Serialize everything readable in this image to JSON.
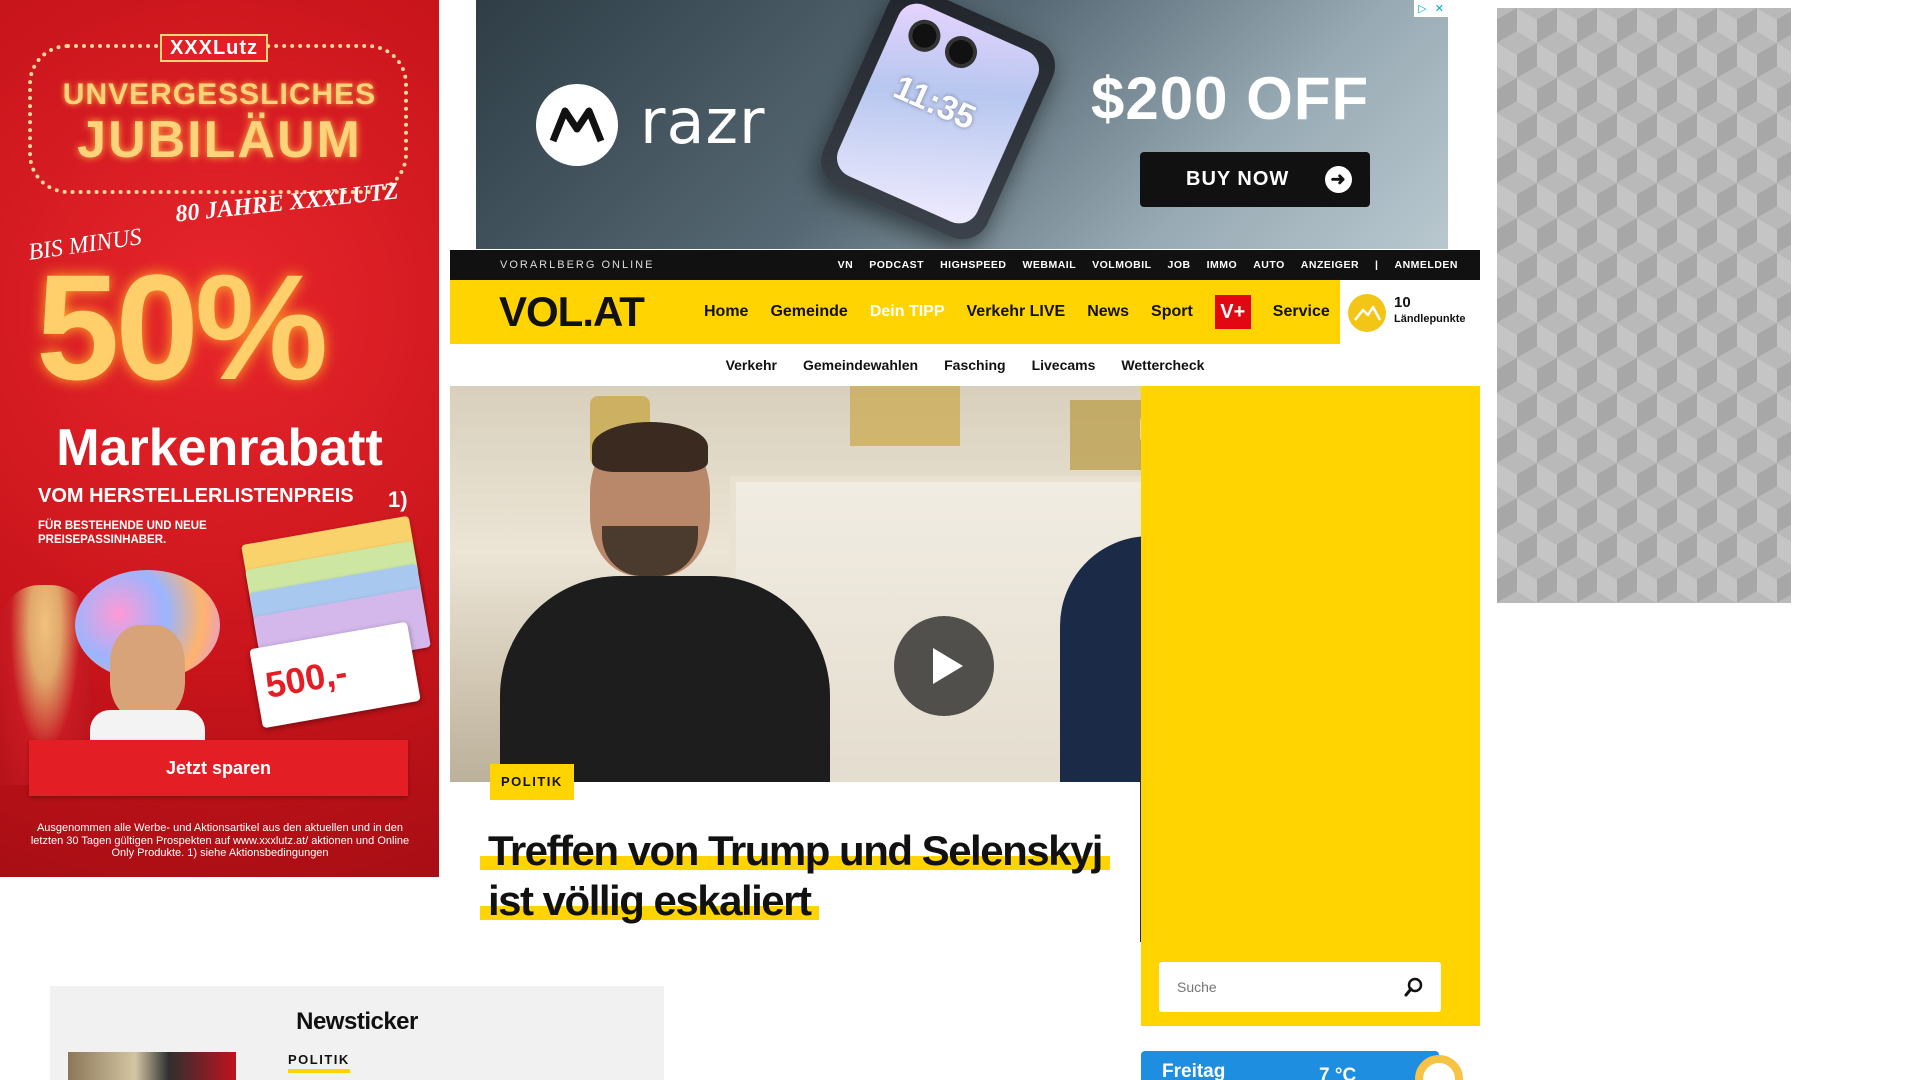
{
  "ads": {
    "left": {
      "brand": "XXXLutz",
      "headline_top": "UNVERGESSLICHES",
      "headline_main": "JUBILÄUM",
      "years": "80 JAHRE XXXLUTZ",
      "bis_minus": "BIS MINUS",
      "percent": "50%",
      "markenrabatt": "Markenrabatt",
      "vom_hersteller": "VOM HERSTELLERLISTENPREIS",
      "footnote_mark": "1)",
      "bestehende": "FÜR BESTEHENDE UND NEUE PREISEPASSINHABER.",
      "voucher_amount": "500,-",
      "cta": "Jetzt sparen",
      "smallprint": "Ausgenommen alle Werbe- und Aktionsartikel aus den aktuellen und in den letzten 30 Tagen gültigen Prospekten auf www.xxxlutz.at/ aktionen und Online Only Produkte. 1) siehe Aktionsbedingungen",
      "colors": {
        "background": "#c8141b",
        "gold": "#ffcf6b"
      }
    },
    "top": {
      "brand": "razr",
      "phone_time": "11:35",
      "offer": "$200 OFF",
      "cta": "BUY NOW",
      "adchoice_icon": "adchoices-icon"
    }
  },
  "site": {
    "topbar": {
      "brandline": "VORARLBERG ONLINE",
      "links": [
        "VN",
        "PODCAST",
        "HIGHSPEED",
        "WEBMAIL",
        "VOLMOBIL",
        "JOB",
        "IMMO",
        "AUTO",
        "ANZEIGER"
      ],
      "separator": "|",
      "login": "ANMELDEN"
    },
    "mainnav": {
      "logo": "VOL.AT",
      "items": [
        "Home",
        "Gemeinde",
        "Dein TIPP",
        "Verkehr LIVE",
        "News",
        "Sport"
      ],
      "vplus": "V+",
      "service": "Service",
      "points_value": "10",
      "points_label": "Ländlepunkte"
    },
    "subnav": [
      "Verkehr",
      "Gemeindewahlen",
      "Fasching",
      "Livecams",
      "Wettercheck"
    ],
    "hero": {
      "tag": "POLITIK",
      "headline": "Treffen von Trump und Selenskyj ist völlig eskaliert"
    },
    "newsticker": {
      "title": "Newsticker",
      "first_tag": "POLITIK"
    },
    "search": {
      "placeholder": "Suche"
    },
    "weather": {
      "day": "Freitag",
      "temp": "7 °C"
    },
    "colors": {
      "brand_yellow": "#ffd400",
      "topbar": "#111111",
      "vplus": "#e30613",
      "weather_blue": "#1e8fe0"
    }
  }
}
